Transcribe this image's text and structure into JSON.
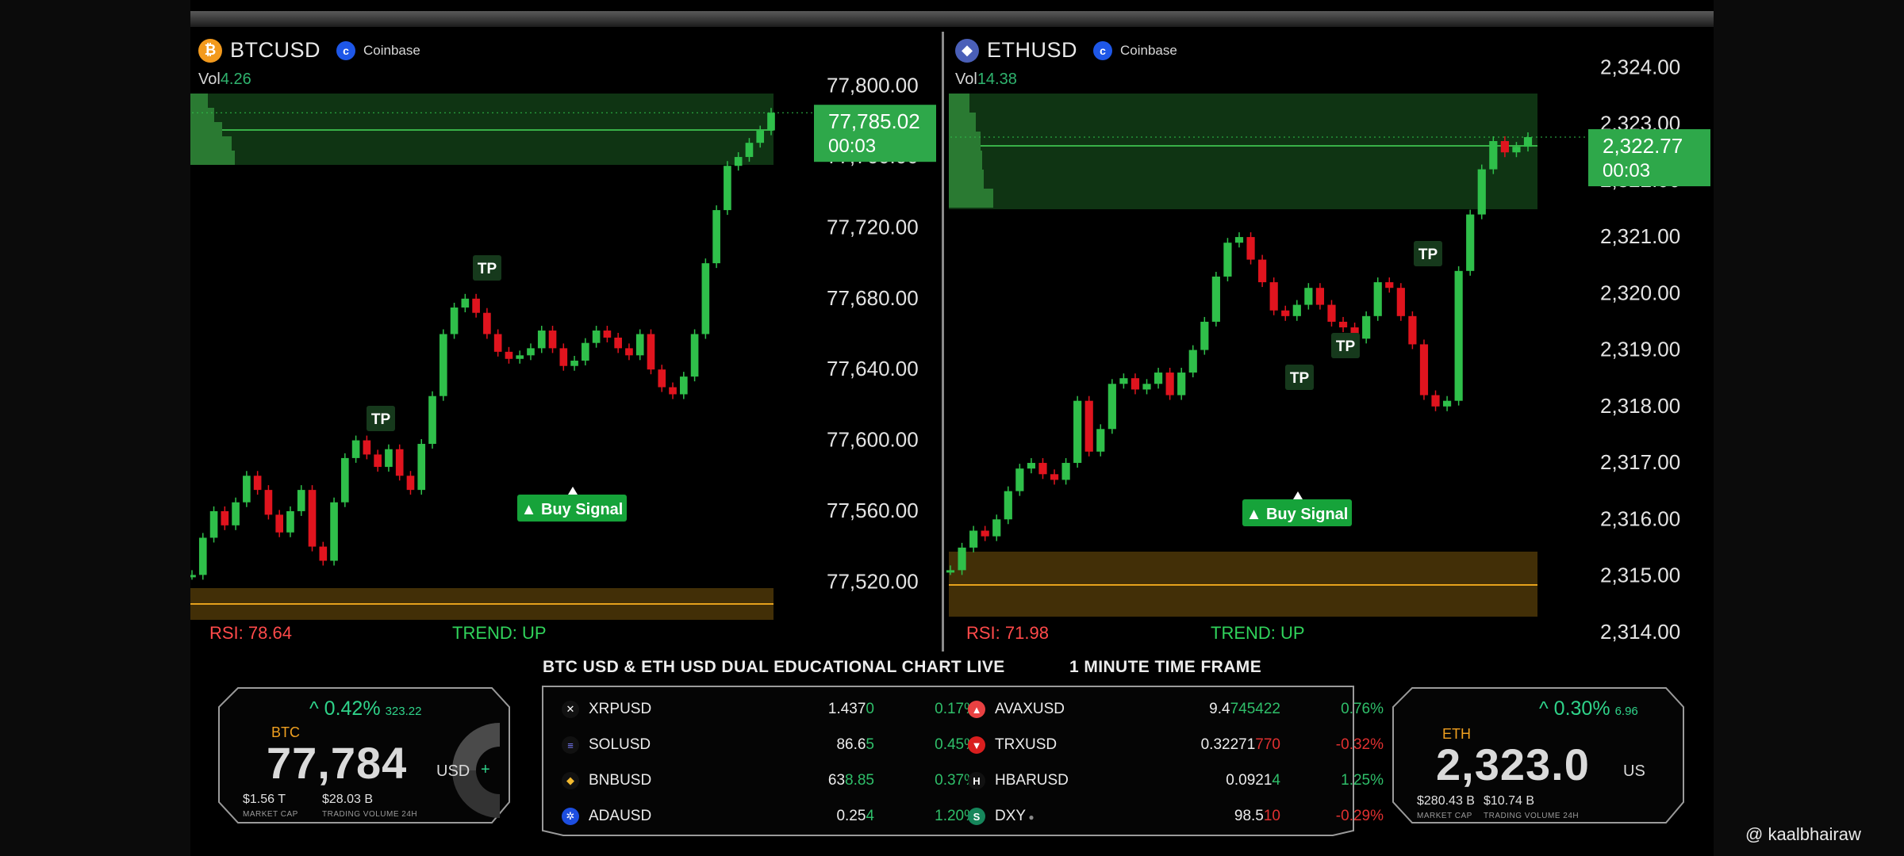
{
  "charts": {
    "btc": {
      "symbol": "BTCUSD",
      "exchange": "Coinbase",
      "vol_label": "Vol",
      "vol_value": "4.26",
      "price_label": "77,785.02",
      "countdown": "00:03",
      "axis_ticks": [
        "77,800.00",
        "77,760.00",
        "77,720.00",
        "77,680.00",
        "77,640.00",
        "77,600.00",
        "77,560.00",
        "77,520.00"
      ],
      "tp_labels": [
        "TP",
        "TP"
      ],
      "buy_signal": "▲ Buy Signal",
      "rsi": "RSI: 78.64",
      "trend": "TREND: UP"
    },
    "eth": {
      "symbol": "ETHUSD",
      "exchange": "Coinbase",
      "vol_label": "Vol",
      "vol_value": "14.38",
      "price_label": "2,322.77",
      "countdown": "00:03",
      "axis_ticks": [
        "2,324.00",
        "2,323.00",
        "2,322.00",
        "2,321.00",
        "2,320.00",
        "2,319.00",
        "2,318.00",
        "2,317.00",
        "2,316.00",
        "2,315.00",
        "2,314.00"
      ],
      "tp_labels": [
        "TP",
        "TP",
        "TP"
      ],
      "buy_signal": "▲ Buy Signal",
      "rsi": "RSI: 71.98",
      "trend": "TREND: UP"
    }
  },
  "chart_data": [
    {
      "type": "line",
      "title": "BTCUSD",
      "ylim": [
        77500,
        77820
      ],
      "series": [
        {
          "values": [
            77524,
            77545,
            77560,
            77552,
            77565,
            77580,
            77572,
            77558,
            77548,
            77560,
            77572,
            77540,
            77532,
            77565,
            77590,
            77600,
            77592,
            77585,
            77595,
            77580,
            77572,
            77598,
            77625,
            77660,
            77675,
            77680,
            77672,
            77660,
            77650,
            77646,
            77648,
            77652,
            77662,
            77652,
            77642,
            77645,
            77655,
            77662,
            77658,
            77652,
            77648,
            77660,
            77640,
            77630,
            77626,
            77636,
            77660,
            77700,
            77730,
            77755,
            77760,
            77768,
            77775,
            77785
          ]
        }
      ]
    },
    {
      "type": "line",
      "title": "ETHUSD",
      "ylim": [
        2313.8,
        2324.3
      ],
      "series": [
        {
          "values": [
            2315.1,
            2315.5,
            2315.8,
            2315.7,
            2316.0,
            2316.5,
            2316.9,
            2317.0,
            2316.8,
            2316.7,
            2317.0,
            2318.1,
            2317.2,
            2317.6,
            2318.4,
            2318.5,
            2318.3,
            2318.4,
            2318.6,
            2318.2,
            2318.6,
            2319.0,
            2319.5,
            2320.3,
            2320.9,
            2321.0,
            2320.6,
            2320.2,
            2319.7,
            2319.6,
            2319.8,
            2320.1,
            2319.8,
            2319.5,
            2319.4,
            2319.2,
            2319.6,
            2320.2,
            2320.1,
            2319.6,
            2319.1,
            2318.2,
            2318.0,
            2318.1,
            2320.4,
            2321.4,
            2322.2,
            2322.7,
            2322.5,
            2322.6,
            2322.77
          ]
        }
      ]
    }
  ],
  "bottom": {
    "title_left": "BTC USD & ETH USD DUAL EDUCATIONAL CHART LIVE",
    "title_right": "1 MINUTE TIME FRAME",
    "btc_card": {
      "pct": "^ 0.42%",
      "pct_small": "323.22",
      "label": "BTC",
      "price": "77,784",
      "unit": "USD",
      "plus": "+",
      "mcap": "$1.56 T",
      "mcap_label": "MARKET CAP",
      "vol24": "$28.03 B",
      "vol24_label": "TRADING VOLUME 24H"
    },
    "eth_card": {
      "pct": "^ 0.30%",
      "pct_small": "6.96",
      "label": "ETH",
      "price": "2,323.0",
      "unit": "US",
      "mcap": "$280.43 B",
      "mcap_label": "MARKET CAP",
      "vol24": "$10.74 B",
      "vol24_label": "TRADING VOLUME 24H"
    },
    "markets_left": [
      {
        "icon": "x-icon",
        "glyph": "✕",
        "name": "XRPUSD",
        "price_main": "1.437",
        "price_tail": "0",
        "change": "0.17%",
        "up": true
      },
      {
        "icon": "solana-icon",
        "glyph": "≡",
        "name": "SOLUSD",
        "price_main": "86.6",
        "price_tail": "5",
        "change": "0.45%",
        "up": true
      },
      {
        "icon": "bnb-icon",
        "glyph": "◆",
        "name": "BNBUSD",
        "price_main": "63",
        "price_tail": "8.85",
        "change": "0.37%",
        "up": true
      },
      {
        "icon": "cardano-icon",
        "glyph": "✲",
        "name": "ADAUSD",
        "price_main": "0.25",
        "price_tail": "4",
        "change": "1.20%",
        "up": true
      }
    ],
    "markets_right": [
      {
        "icon": "avalanche-icon",
        "glyph": "▲",
        "name": "AVAXUSD",
        "price_main": "9.4",
        "price_tail": "745422",
        "change": "0.76%",
        "up": true
      },
      {
        "icon": "tron-icon",
        "glyph": "▼",
        "name": "TRXUSD",
        "price_main": "0.32271",
        "price_tail": "770",
        "change": "-0.32%",
        "up": false
      },
      {
        "icon": "hedera-icon",
        "glyph": "H",
        "name": "HBARUSD",
        "price_main": "0.0921",
        "price_tail": "4",
        "change": "1.25%",
        "up": true
      },
      {
        "icon": "dollar-icon",
        "glyph": "S",
        "name": "DXY",
        "dot": "●",
        "price_main": "98.5",
        "price_tail": "10",
        "change": "-0.29%",
        "up": false
      }
    ]
  },
  "watermark": "@ kaalbhairaw",
  "colors": {
    "up": "#2fbf4a",
    "down": "#e0141e",
    "zone_green": "#1f6b27",
    "zone_orange": "#7a5a10",
    "price_box": "#2ea84a"
  }
}
